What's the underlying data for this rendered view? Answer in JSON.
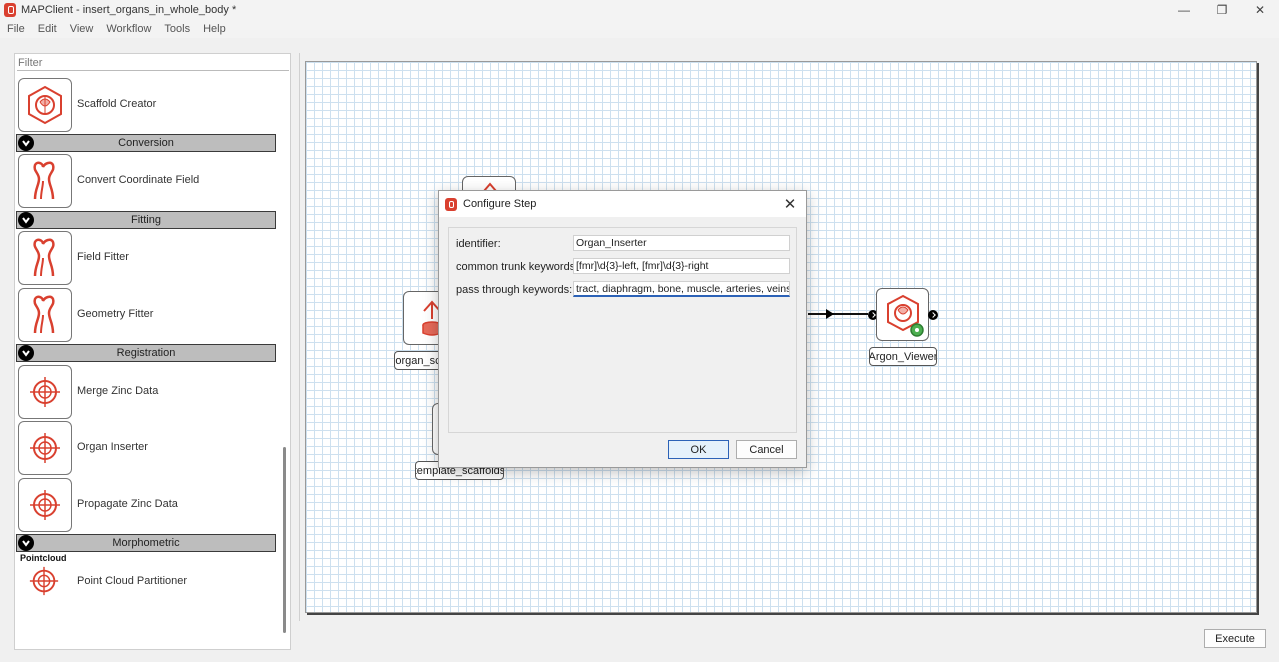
{
  "window": {
    "title": "MAPClient - insert_organs_in_whole_body *",
    "controls": {
      "minimize": "—",
      "maximize": "❐",
      "close": "✕"
    }
  },
  "menu": [
    "File",
    "Edit",
    "View",
    "Workflow",
    "Tools",
    "Help"
  ],
  "step_panel": {
    "filter_placeholder": "Filter",
    "items": [
      {
        "label": "Scaffold Creator",
        "icon": "scaffold-creator-icon"
      },
      {
        "category": "Conversion"
      },
      {
        "label": "Convert Coordinate Field",
        "icon": "bone-icon"
      },
      {
        "category": "Fitting"
      },
      {
        "label": "Field Fitter",
        "icon": "bone-icon"
      },
      {
        "label": "Geometry Fitter",
        "icon": "bone-icon"
      },
      {
        "category": "Registration"
      },
      {
        "label": "Merge Zinc Data",
        "icon": "crosshair-icon"
      },
      {
        "label": "Organ Inserter",
        "icon": "crosshair-icon"
      },
      {
        "label": "Propagate Zinc Data",
        "icon": "crosshair-icon"
      },
      {
        "category": "Morphometric"
      },
      {
        "subheading": "Pointcloud"
      },
      {
        "label": "Point Cloud Partitioner",
        "icon": "crosshair-icon"
      }
    ]
  },
  "workflow": {
    "nodes": [
      {
        "label": "organ_sc",
        "icon": "file-upload-icon"
      },
      {
        "label": "template_scaffolds",
        "icon": "file-icon"
      },
      {
        "label": "Argon_Viewer",
        "icon": "argon-viewer-icon"
      }
    ]
  },
  "dialog": {
    "title": "Configure Step",
    "fields": [
      {
        "label": "identifier:",
        "value": "Organ_Inserter"
      },
      {
        "label": "common trunk keywords:",
        "value": "[fmr]\\d{3}-left, [fmr]\\d{3}-right"
      },
      {
        "label": "pass through keywords:",
        "value": "tract, diaphragm, bone, muscle, arteries, veins"
      }
    ],
    "ok_label": "OK",
    "cancel_label": "Cancel",
    "close_glyph": "✕"
  },
  "execute_label": "Execute",
  "colors": {
    "accent": "#2c62b7",
    "brand": "#d9402f",
    "grid": "#cde0ef"
  }
}
